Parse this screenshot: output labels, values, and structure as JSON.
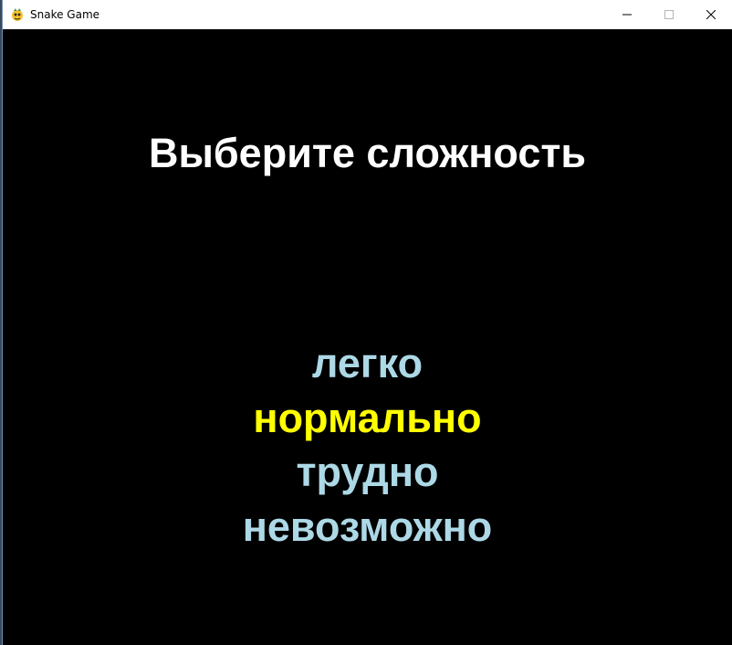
{
  "window": {
    "title": "Snake Game",
    "app_icon": "pygame-snake-icon",
    "controls": [
      "minimize-icon",
      "maximize-icon",
      "close-icon"
    ]
  },
  "colors": {
    "background": "#000000",
    "heading": "#ffffff",
    "option_default": "#add8e6",
    "option_selected": "#ffff00"
  },
  "menu": {
    "heading": "Выберите сложность",
    "selected_index": 1,
    "options": [
      {
        "label": "легко"
      },
      {
        "label": "нормально"
      },
      {
        "label": "трудно"
      },
      {
        "label": "невозможно"
      }
    ]
  }
}
